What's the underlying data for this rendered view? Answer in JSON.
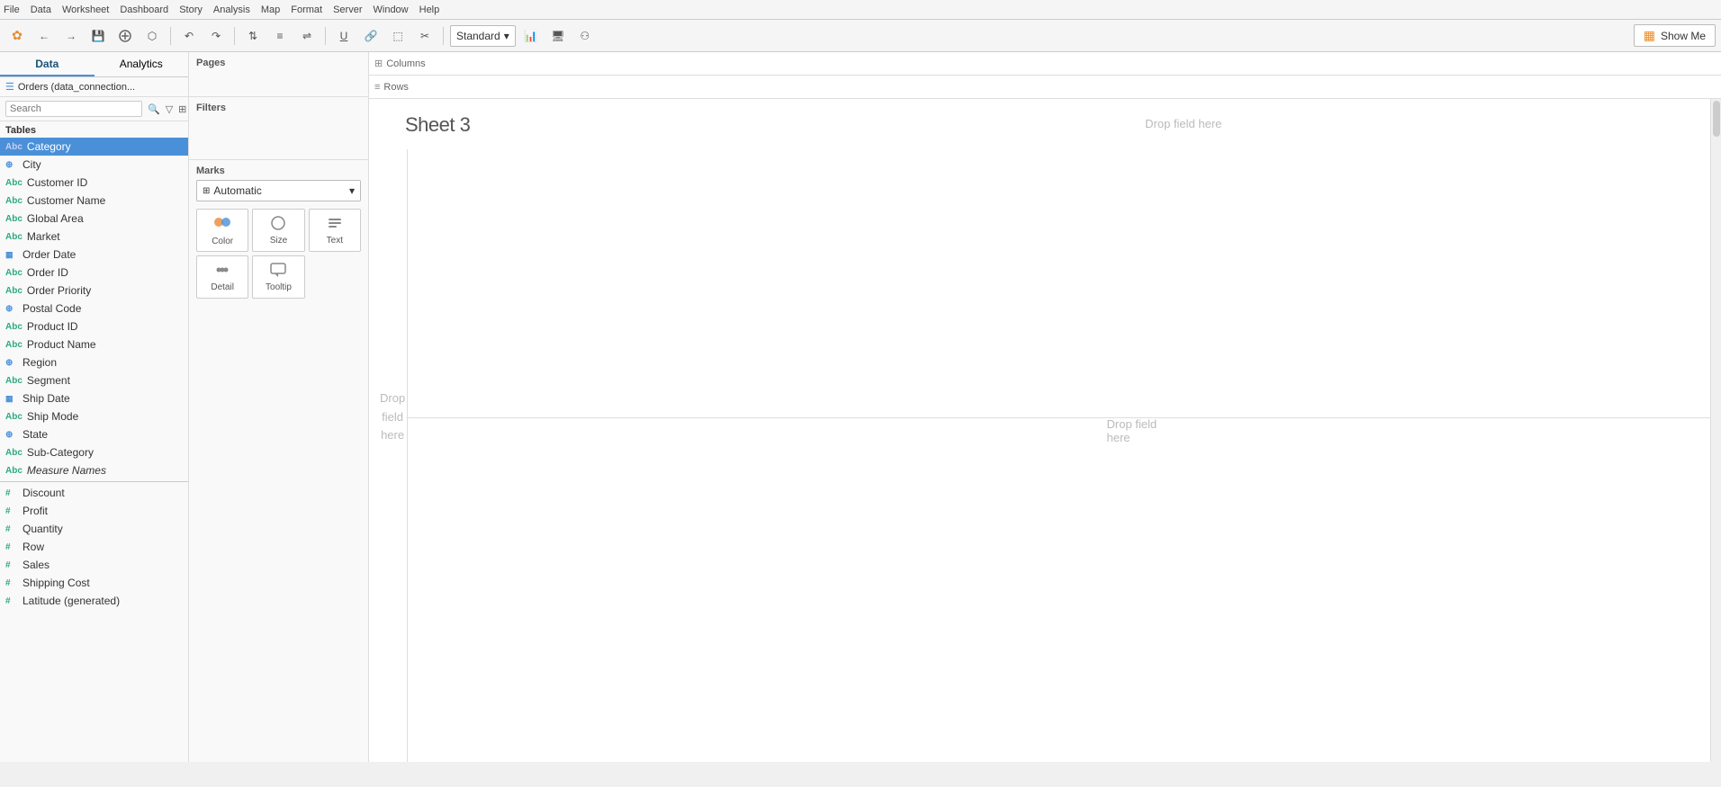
{
  "menubar": {
    "items": [
      "File",
      "Data",
      "Worksheet",
      "Dashboard",
      "Story",
      "Analysis",
      "Map",
      "Format",
      "Server",
      "Window",
      "Help"
    ]
  },
  "toolbar": {
    "standard_label": "Standard",
    "show_me_label": "Show Me"
  },
  "tabs": {
    "data_label": "Data",
    "analytics_label": "Analytics"
  },
  "data_source": {
    "icon": "☰",
    "label": "Orders (data_connection..."
  },
  "search": {
    "placeholder": "Search"
  },
  "tables_label": "Tables",
  "fields": [
    {
      "id": "category",
      "type": "Abc",
      "type_class": "string",
      "name": "Category",
      "selected": true
    },
    {
      "id": "city",
      "type": "⊕",
      "type_class": "measure",
      "name": "City",
      "selected": false
    },
    {
      "id": "customer-id",
      "type": "Abc",
      "type_class": "string",
      "name": "Customer ID",
      "selected": false
    },
    {
      "id": "customer-name",
      "type": "Abc",
      "type_class": "string",
      "name": "Customer Name",
      "selected": false
    },
    {
      "id": "global-area",
      "type": "Abc",
      "type_class": "string",
      "name": "Global Area",
      "selected": false
    },
    {
      "id": "market",
      "type": "Abc",
      "type_class": "string",
      "name": "Market",
      "selected": false
    },
    {
      "id": "order-date",
      "type": "▦",
      "type_class": "date",
      "name": "Order Date",
      "selected": false
    },
    {
      "id": "order-id",
      "type": "Abc",
      "type_class": "string",
      "name": "Order ID",
      "selected": false
    },
    {
      "id": "order-priority",
      "type": "Abc",
      "type_class": "string",
      "name": "Order Priority",
      "selected": false
    },
    {
      "id": "postal-code",
      "type": "⊕",
      "type_class": "measure",
      "name": "Postal Code",
      "selected": false
    },
    {
      "id": "product-id",
      "type": "Abc",
      "type_class": "string",
      "name": "Product ID",
      "selected": false
    },
    {
      "id": "product-name",
      "type": "Abc",
      "type_class": "string",
      "name": "Product Name",
      "selected": false
    },
    {
      "id": "region",
      "type": "⊕",
      "type_class": "measure",
      "name": "Region",
      "selected": false
    },
    {
      "id": "segment",
      "type": "Abc",
      "type_class": "string",
      "name": "Segment",
      "selected": false
    },
    {
      "id": "ship-date",
      "type": "▦",
      "type_class": "date",
      "name": "Ship Date",
      "selected": false
    },
    {
      "id": "ship-mode",
      "type": "Abc",
      "type_class": "string",
      "name": "Ship Mode",
      "selected": false
    },
    {
      "id": "state",
      "type": "⊕",
      "type_class": "measure",
      "name": "State",
      "selected": false
    },
    {
      "id": "sub-category",
      "type": "Abc",
      "type_class": "string",
      "name": "Sub-Category",
      "selected": false
    },
    {
      "id": "measure-names",
      "type": "Abc",
      "type_class": "string",
      "name": "Measure Names",
      "italic": true,
      "selected": false
    }
  ],
  "measures": [
    {
      "id": "discount",
      "type": "#",
      "name": "Discount"
    },
    {
      "id": "profit",
      "type": "#",
      "name": "Profit"
    },
    {
      "id": "quantity",
      "type": "#",
      "name": "Quantity"
    },
    {
      "id": "row",
      "type": "#",
      "name": "Row"
    },
    {
      "id": "sales",
      "type": "#",
      "name": "Sales"
    },
    {
      "id": "shipping-cost",
      "type": "#",
      "name": "Shipping Cost"
    },
    {
      "id": "latitude",
      "type": "#",
      "name": "Latitude (generated)"
    }
  ],
  "sections": {
    "pages_label": "Pages",
    "filters_label": "Filters",
    "marks_label": "Marks"
  },
  "marks": {
    "dropdown_label": "Automatic",
    "buttons": [
      {
        "id": "color",
        "icon": "⬤⬤",
        "label": "Color"
      },
      {
        "id": "size",
        "icon": "○",
        "label": "Size"
      },
      {
        "id": "text",
        "icon": "T",
        "label": "Text"
      },
      {
        "id": "detail",
        "icon": "∘∘∘",
        "label": "Detail"
      },
      {
        "id": "tooltip",
        "icon": "☁",
        "label": "Tooltip"
      }
    ]
  },
  "shelves": {
    "columns_label": "Columns",
    "rows_label": "Rows"
  },
  "canvas": {
    "sheet_title": "Sheet 3",
    "drop_field_top": "Drop field here",
    "drop_field_mid": "Drop field here",
    "drop_field_left_1": "Drop",
    "drop_field_left_2": "field",
    "drop_field_left_3": "here"
  }
}
